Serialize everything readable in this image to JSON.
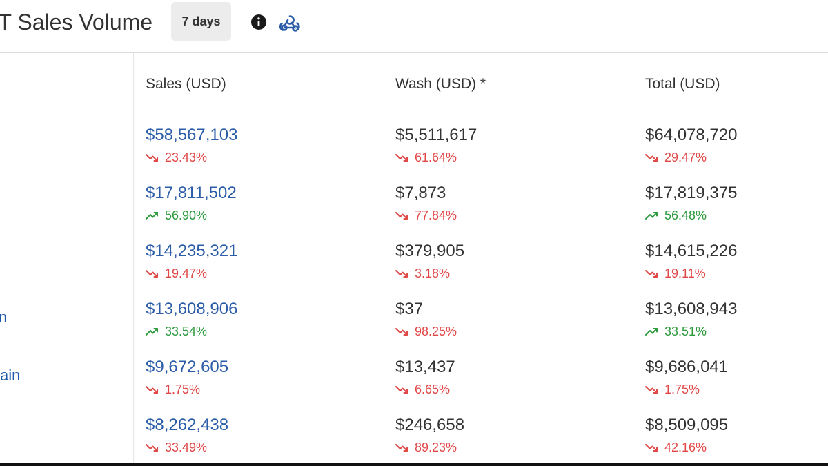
{
  "header": {
    "title": "FT Sales Volume",
    "period_label": "7 days",
    "info_icon": "info-icon",
    "webhook_icon": "webhook-icon"
  },
  "table": {
    "columns": [
      "",
      "Sales (USD)",
      "Wash (USD) *",
      "Total (USD)"
    ],
    "rows": [
      {
        "name": "",
        "sales": "$58,567,103",
        "sales_change": "23.43%",
        "sales_dir": "down",
        "wash": "$5,511,617",
        "wash_change": "61.64%",
        "wash_dir": "down",
        "total": "$64,078,720",
        "total_change": "29.47%",
        "total_dir": "down"
      },
      {
        "name": "",
        "sales": "$17,811,502",
        "sales_change": "56.90%",
        "sales_dir": "up",
        "wash": "$7,873",
        "wash_change": "77.84%",
        "wash_dir": "down",
        "total": "$17,819,375",
        "total_change": "56.48%",
        "total_dir": "up"
      },
      {
        "name": "",
        "sales": "$14,235,321",
        "sales_change": "19.47%",
        "sales_dir": "down",
        "wash": "$379,905",
        "wash_change": "3.18%",
        "wash_dir": "down",
        "total": "$14,615,226",
        "total_change": "19.11%",
        "total_dir": "down"
      },
      {
        "name": "n",
        "sales": "$13,608,906",
        "sales_change": "33.54%",
        "sales_dir": "up",
        "wash": "$37",
        "wash_change": "98.25%",
        "wash_dir": "down",
        "total": "$13,608,943",
        "total_change": "33.51%",
        "total_dir": "up"
      },
      {
        "name": "ain",
        "sales": "$9,672,605",
        "sales_change": "1.75%",
        "sales_dir": "down",
        "wash": "$13,437",
        "wash_change": "6.65%",
        "wash_dir": "down",
        "total": "$9,686,041",
        "total_change": "1.75%",
        "total_dir": "down"
      },
      {
        "name": "",
        "sales": "$8,262,438",
        "sales_change": "33.49%",
        "sales_dir": "down",
        "wash": "$246,658",
        "wash_change": "89.23%",
        "wash_dir": "down",
        "total": "$8,509,095",
        "total_change": "42.16%",
        "total_dir": "down"
      }
    ]
  },
  "colors": {
    "link_blue": "#2b5ca8",
    "negative_red": "#e04848",
    "positive_green": "#2e9a3e",
    "text": "#333333",
    "button_bg": "#ececec"
  }
}
